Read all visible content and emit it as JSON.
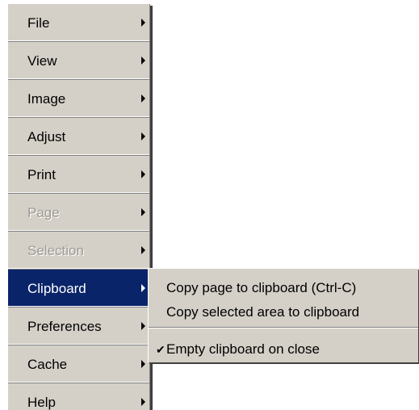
{
  "menu": {
    "items": [
      {
        "label": "File",
        "state": "normal"
      },
      {
        "label": "View",
        "state": "normal"
      },
      {
        "label": "Image",
        "state": "normal"
      },
      {
        "label": "Adjust",
        "state": "normal"
      },
      {
        "label": "Print",
        "state": "normal"
      },
      {
        "label": "Page",
        "state": "disabled"
      },
      {
        "label": "Selection",
        "state": "disabled"
      },
      {
        "label": "Clipboard",
        "state": "selected"
      },
      {
        "label": "Preferences",
        "state": "normal"
      },
      {
        "label": "Cache",
        "state": "normal"
      },
      {
        "label": "Help",
        "state": "normal"
      }
    ]
  },
  "submenu": {
    "items": [
      {
        "label": "Copy page to clipboard (Ctrl-C)",
        "checked": false
      },
      {
        "label": "Copy selected area to clipboard",
        "checked": false
      },
      {
        "label": "Empty clipboard on close",
        "checked": true
      }
    ]
  },
  "icons": {
    "submenu_arrow": "chevron-right-icon",
    "checkmark": "check-icon"
  },
  "colors": {
    "menu_background": "#d4d0c8",
    "selection_background": "#0a246a",
    "selection_text": "#ffffff",
    "disabled_text": "#9c9a94"
  }
}
